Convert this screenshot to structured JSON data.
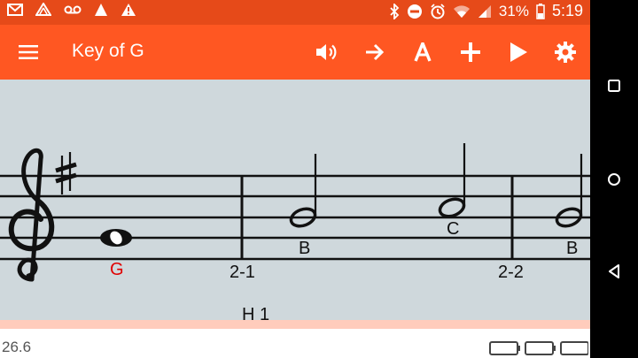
{
  "status_bar": {
    "battery_percent": "31%",
    "time": "5:19",
    "icons": [
      "gmail-icon",
      "drive-icon",
      "voicemail-icon",
      "signal-triangle-icon",
      "warning-icon",
      "bluetooth-icon",
      "dnd-icon",
      "alarm-icon",
      "wifi-icon",
      "cell-signal-icon",
      "battery-icon"
    ]
  },
  "app_bar": {
    "title": "Key of G",
    "actions": [
      "menu-icon",
      "volume-icon",
      "arrow-right-icon",
      "font-a-icon",
      "add-icon",
      "play-icon",
      "settings-icon"
    ]
  },
  "score": {
    "notes": [
      {
        "letter": "G",
        "color": "#e00000"
      },
      {
        "letter": "B",
        "color": "#111111"
      },
      {
        "letter": "C",
        "color": "#111111"
      },
      {
        "letter": "B",
        "color": "#111111"
      }
    ],
    "measure_labels": [
      "2-1",
      "2-2"
    ],
    "section_label": "H 1"
  },
  "footer": {
    "zoom": "26.6"
  },
  "nav_bar": [
    "square-nav-icon",
    "circle-nav-icon",
    "back-triangle-icon"
  ]
}
